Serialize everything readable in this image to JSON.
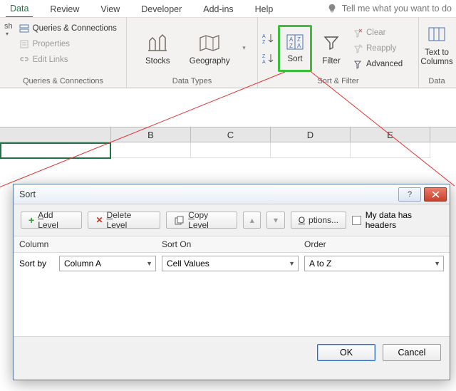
{
  "tabs": {
    "data": "Data",
    "review": "Review",
    "view": "View",
    "developer": "Developer",
    "addins": "Add-ins",
    "help": "Help"
  },
  "tellme": "Tell me what you want to do",
  "ribbon": {
    "qc": {
      "queries": "Queries & Connections",
      "properties": "Properties",
      "edit": "Edit Links",
      "group": "Queries & Connections"
    },
    "dt": {
      "stocks": "Stocks",
      "geo": "Geography",
      "group": "Data Types"
    },
    "sf": {
      "sort": "Sort",
      "filter": "Filter",
      "clear": "Clear",
      "reapply": "Reapply",
      "advanced": "Advanced",
      "group": "Sort & Filter"
    },
    "tools": {
      "texttocols": "Text to\nColumns",
      "group": "Data"
    }
  },
  "cols": {
    "b": "B",
    "c": "C",
    "d": "D",
    "e": "E"
  },
  "dialog": {
    "title": "Sort",
    "add": "Add Level",
    "del": "Delete Level",
    "copy": "Copy Level",
    "options": "Options...",
    "headers": "My data has headers",
    "hdr_col": "Column",
    "hdr_sorton": "Sort On",
    "hdr_order": "Order",
    "sortby_lbl": "Sort by",
    "sortby_val": "Column A",
    "sorton_val": "Cell Values",
    "order_val": "A to Z",
    "ok": "OK",
    "cancel": "Cancel"
  }
}
